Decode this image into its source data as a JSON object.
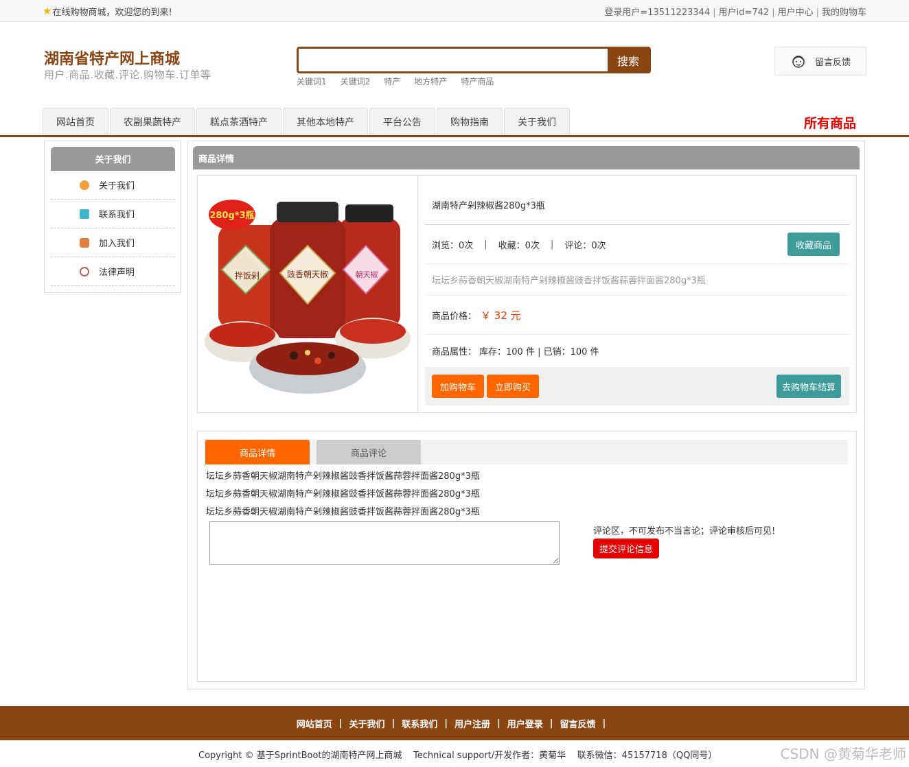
{
  "topbar": {
    "welcome": "在线购物商城，欢迎您的到来!",
    "user_login": "登录用户=13511223344",
    "user_id": "用户id=742",
    "user_center": "用户中心",
    "my_cart": "我的购物车"
  },
  "header": {
    "title": "湖南省特产网上商城",
    "subtitle": "用户.商品.收藏.评论.购物车.订单等",
    "search_value": "",
    "search_button": "搜索",
    "hotwords": [
      "关键词1",
      "关键词2",
      "特产",
      "地方特产",
      "特产商品"
    ],
    "feedback": "留言反馈"
  },
  "nav": {
    "tabs": [
      "网站首页",
      "农副果蔬特产",
      "糕点茶酒特产",
      "其他本地特产",
      "平台公告",
      "购物指南",
      "关于我们"
    ],
    "all_goods": "所有商品"
  },
  "sidebar": {
    "title": "关于我们",
    "items": [
      {
        "label": "关于我们",
        "icon": "about-icon",
        "color": "#f0a040"
      },
      {
        "label": "联系我们",
        "icon": "contact-icon",
        "color": "#40b8d0"
      },
      {
        "label": "加入我们",
        "icon": "lock-icon",
        "color": "#e08040"
      },
      {
        "label": "法律声明",
        "icon": "power-icon",
        "color": "#c06060"
      }
    ]
  },
  "main": {
    "title": "商品详情",
    "product": {
      "image_badge": "280g*3瓶",
      "image_labels": [
        "拌饭剁",
        "豉香朝天椒",
        "朝天椒"
      ],
      "name": "湖南特产剁辣椒酱280g*3瓶",
      "views": "浏览：0次",
      "favorites": "收藏：0次",
      "comments": "评论：0次",
      "fav_button": "收藏商品",
      "description": "坛坛乡蒜香朝天椒湖南特产剁辣椒酱豉香拌饭酱蒜蓉拌面酱280g*3瓶",
      "price_label": "商品价格：",
      "price": "￥ 32 元",
      "attr_label": "商品属性：",
      "attr_value": "库存：100 件 | 已销：100 件",
      "add_cart": "加购物车",
      "buy_now": "立即购买",
      "checkout": "去购物车结算"
    },
    "tabs": {
      "active": "商品详情",
      "inactive": "商品评论"
    },
    "detail_lines": [
      "坛坛乡蒜香朝天椒湖南特产剁辣椒酱豉香拌饭酱蒜蓉拌面酱280g*3瓶",
      "坛坛乡蒜香朝天椒湖南特产剁辣椒酱豉香拌饭酱蒜蓉拌面酱280g*3瓶",
      "坛坛乡蒜香朝天椒湖南特产剁辣椒酱豉香拌饭酱蒜蓉拌面酱280g*3瓶"
    ],
    "comment_note": "评论区，不可发布不当言论；评论审核后可见!",
    "comment_submit": "提交评论信息"
  },
  "footer": {
    "links": [
      "网站首页",
      "关于我们",
      "联系我们",
      "用户注册",
      "用户登录",
      "留言反馈"
    ],
    "copyright": "Copyright © 基于SprintBoot的湖南特产网上商城    Technical support/开发作者：黄菊华    联系微信：45157718（QQ同号）",
    "watermark": "CSDN @黄菊华老师"
  },
  "colors": {
    "brand": "#8b4513",
    "accent_orange": "#ff6600",
    "teal": "#3d9c9a",
    "red": "#e60000"
  }
}
